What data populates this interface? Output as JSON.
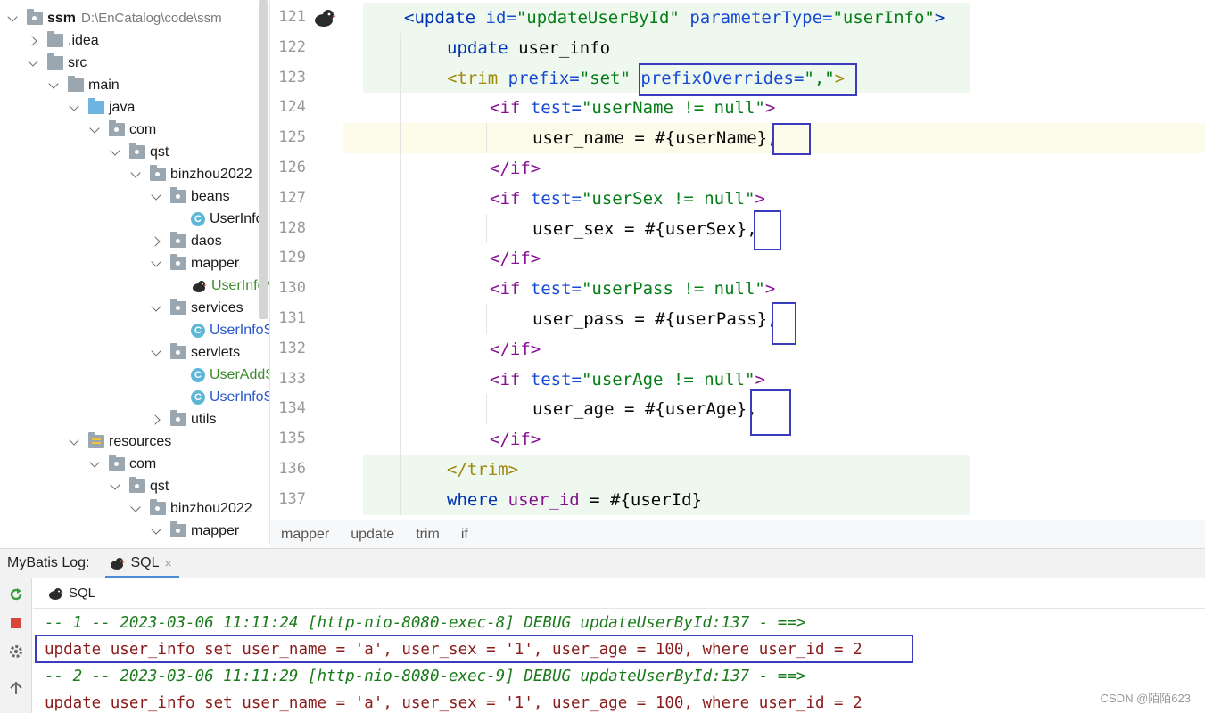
{
  "project_tree": {
    "items": [
      {
        "label": "ssm",
        "path": "D:\\EnCatalog\\code\\ssm",
        "depth": 0,
        "state": "open",
        "icon": "module-folder-icon",
        "style": "bold"
      },
      {
        "label": ".idea",
        "depth": 1,
        "state": "closed",
        "icon": "folder-icon"
      },
      {
        "label": "src",
        "depth": 1,
        "state": "open",
        "icon": "folder-icon"
      },
      {
        "label": "main",
        "depth": 2,
        "state": "open",
        "icon": "folder-icon"
      },
      {
        "label": "java",
        "depth": 3,
        "state": "open",
        "icon": "source-folder-icon"
      },
      {
        "label": "com",
        "depth": 4,
        "state": "open",
        "icon": "package-icon"
      },
      {
        "label": "qst",
        "depth": 5,
        "state": "open",
        "icon": "package-icon"
      },
      {
        "label": "binzhou2022",
        "depth": 6,
        "state": "open",
        "icon": "package-icon"
      },
      {
        "label": "beans",
        "depth": 7,
        "state": "open",
        "icon": "package-icon"
      },
      {
        "label": "UserInfo",
        "depth": 8,
        "state": "leaf",
        "icon": "class-icon"
      },
      {
        "label": "daos",
        "depth": 7,
        "state": "closed",
        "icon": "package-icon"
      },
      {
        "label": "mapper",
        "depth": 7,
        "state": "open",
        "icon": "package-icon"
      },
      {
        "label": "UserInfoM",
        "depth": 8,
        "state": "leaf",
        "icon": "mybatis-bird-icon",
        "color": "green"
      },
      {
        "label": "services",
        "depth": 7,
        "state": "open",
        "icon": "package-icon"
      },
      {
        "label": "UserInfoS",
        "depth": 8,
        "state": "leaf",
        "icon": "class-icon",
        "color": "blue"
      },
      {
        "label": "servlets",
        "depth": 7,
        "state": "open",
        "icon": "package-icon"
      },
      {
        "label": "UserAddS",
        "depth": 8,
        "state": "leaf",
        "icon": "class-icon",
        "color": "green"
      },
      {
        "label": "UserInfoS",
        "depth": 8,
        "state": "leaf",
        "icon": "class-icon",
        "color": "blue"
      },
      {
        "label": "utils",
        "depth": 7,
        "state": "closed",
        "icon": "package-icon"
      },
      {
        "label": "resources",
        "depth": 3,
        "state": "open",
        "icon": "resources-folder-icon"
      },
      {
        "label": "com",
        "depth": 4,
        "state": "open",
        "icon": "package-icon"
      },
      {
        "label": "qst",
        "depth": 5,
        "state": "open",
        "icon": "package-icon"
      },
      {
        "label": "binzhou2022",
        "depth": 6,
        "state": "open",
        "icon": "package-icon"
      },
      {
        "label": "mapper",
        "depth": 7,
        "state": "open",
        "icon": "package-icon"
      }
    ]
  },
  "editor": {
    "lines": [
      {
        "num": "121",
        "tokens": [
          [
            "t-tag",
            "<update "
          ],
          [
            "t-attr",
            "id="
          ],
          [
            "t-str",
            "\"updateUserById\" "
          ],
          [
            "t-attr",
            "parameterType="
          ],
          [
            "t-str",
            "\"userInfo\""
          ],
          [
            "t-tag",
            ">"
          ]
        ]
      },
      {
        "num": "122",
        "tokens": [
          [
            "t-kw",
            "update "
          ],
          [
            "",
            "user_info"
          ]
        ]
      },
      {
        "num": "123",
        "tokens": [
          [
            "t-tag2",
            "<trim "
          ],
          [
            "t-attr",
            "prefix="
          ],
          [
            "t-str",
            "\"set\" "
          ],
          [
            "t-attr",
            "prefixOverrides="
          ],
          [
            "t-str",
            "\",\""
          ],
          [
            "t-tag2",
            ">"
          ]
        ]
      },
      {
        "num": "124",
        "tokens": [
          [
            "t-tag3",
            "<if "
          ],
          [
            "t-attr",
            "test="
          ],
          [
            "t-str",
            "\"userName != null\""
          ],
          [
            "t-tag3",
            ">"
          ]
        ]
      },
      {
        "num": "125",
        "tokens": [
          [
            "",
            "user_name = #{userName},"
          ]
        ]
      },
      {
        "num": "126",
        "tokens": [
          [
            "t-tag3",
            "</if>"
          ]
        ]
      },
      {
        "num": "127",
        "tokens": [
          [
            "t-tag3",
            "<if "
          ],
          [
            "t-attr",
            "test="
          ],
          [
            "t-str",
            "\"userSex != null\""
          ],
          [
            "t-tag3",
            ">"
          ]
        ]
      },
      {
        "num": "128",
        "tokens": [
          [
            "",
            "user_sex = #{userSex},"
          ]
        ]
      },
      {
        "num": "129",
        "tokens": [
          [
            "t-tag3",
            "</if>"
          ]
        ]
      },
      {
        "num": "130",
        "tokens": [
          [
            "t-tag3",
            "<if "
          ],
          [
            "t-attr",
            "test="
          ],
          [
            "t-str",
            "\"userPass != null\""
          ],
          [
            "t-tag3",
            ">"
          ]
        ]
      },
      {
        "num": "131",
        "tokens": [
          [
            "",
            "user_pass = #{userPass},"
          ]
        ]
      },
      {
        "num": "132",
        "tokens": [
          [
            "t-tag3",
            "</if>"
          ]
        ]
      },
      {
        "num": "133",
        "tokens": [
          [
            "t-tag3",
            "<if "
          ],
          [
            "t-attr",
            "test="
          ],
          [
            "t-str",
            "\"userAge != null\""
          ],
          [
            "t-tag3",
            ">"
          ]
        ]
      },
      {
        "num": "134",
        "tokens": [
          [
            "",
            "user_age = #{userAge},"
          ]
        ]
      },
      {
        "num": "135",
        "tokens": [
          [
            "t-tag3",
            "</if>"
          ]
        ]
      },
      {
        "num": "136",
        "tokens": [
          [
            "t-tag2",
            "</trim>"
          ]
        ]
      },
      {
        "num": "137",
        "tokens": [
          [
            "t-kw",
            "where "
          ],
          [
            "t-col",
            "user_id "
          ],
          [
            "",
            "= #{userId}"
          ]
        ]
      }
    ]
  },
  "breadcrumb": [
    "mapper",
    "update",
    "trim",
    "if"
  ],
  "tool_window": {
    "title": "MyBatis Log:",
    "tab_label": "SQL",
    "close_glyph": "×",
    "sub_label": "SQL"
  },
  "log": [
    {
      "kind": "comment",
      "text": "-- 1 -- 2023-03-06 11:11:24 [http-nio-8080-exec-8] DEBUG updateUserById:137 - ==>"
    },
    {
      "kind": "sql",
      "text": "update user_info set user_name = 'a', user_sex = '1', user_age = 100, where user_id = 2"
    },
    {
      "kind": "comment",
      "text": "-- 2 -- 2023-03-06 11:11:29 [http-nio-8080-exec-9] DEBUG updateUserById:137 - ==>"
    },
    {
      "kind": "sql",
      "text": "update user_info set user_name = 'a', user_sex = '1', user_age = 100, where user_id = 2"
    }
  ],
  "watermark": "CSDN @陌陌623",
  "colors": {
    "highlight_box": "#3b3bbd",
    "tab_underline": "#4d8ad5",
    "log_comment": "#1b7a1b",
    "log_sql": "#8b1c1c"
  }
}
